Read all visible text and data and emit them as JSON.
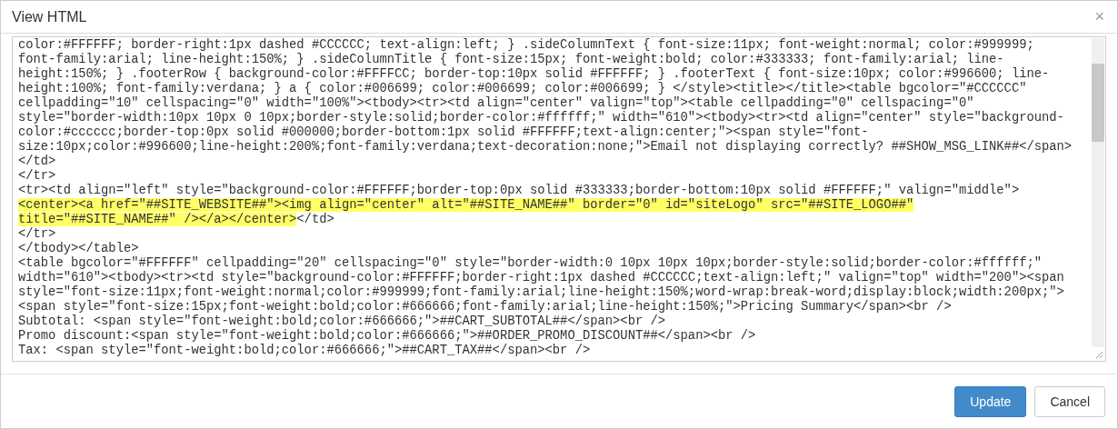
{
  "dialog": {
    "title": "View HTML",
    "close": "×"
  },
  "editor": {
    "lines": [
      {
        "segments": [
          {
            "text": "color:#FFFFFF; border-right:1px dashed #CCCCCC; text-align:left; } .sideColumnText { font-size:11px; font-weight:normal; color:#999999;",
            "highlighted": false
          }
        ]
      },
      {
        "segments": [
          {
            "text": "font-family:arial; line-height:150%; } .sideColumnTitle { font-size:15px; font-weight:bold; color:#333333; font-family:arial; line-",
            "highlighted": false
          }
        ]
      },
      {
        "segments": [
          {
            "text": "height:150%; } .footerRow { background-color:#FFFFCC; border-top:10px solid #FFFFFF; } .footerText { font-size:10px; color:#996600; line-",
            "highlighted": false
          }
        ]
      },
      {
        "segments": [
          {
            "text": "height:100%; font-family:verdana; } a { color:#006699; color:#006699; color:#006699; } </style><title></title><table bgcolor=\"#CCCCCC\"",
            "highlighted": false
          }
        ]
      },
      {
        "segments": [
          {
            "text": "cellpadding=\"10\" cellspacing=\"0\" width=\"100%\"><tbody><tr><td align=\"center\" valign=\"top\"><table cellpadding=\"0\" cellspacing=\"0\"",
            "highlighted": false
          }
        ]
      },
      {
        "segments": [
          {
            "text": "style=\"border-width:10px 10px 0 10px;border-style:solid;border-color:#ffffff;\" width=\"610\"><tbody><tr><td align=\"center\" style=\"background-",
            "highlighted": false
          }
        ]
      },
      {
        "segments": [
          {
            "text": "color:#cccccc;border-top:0px solid #000000;border-bottom:1px solid #FFFFFF;text-align:center;\"><span style=\"font-",
            "highlighted": false
          }
        ]
      },
      {
        "segments": [
          {
            "text": "size:10px;color:#996600;line-height:200%;font-family:verdana;text-decoration:none;\">Email not displaying correctly? ##SHOW_MSG_LINK##</span>",
            "highlighted": false
          }
        ]
      },
      {
        "segments": [
          {
            "text": "</td>",
            "highlighted": false
          }
        ]
      },
      {
        "segments": [
          {
            "text": "</tr>",
            "highlighted": false
          }
        ]
      },
      {
        "segments": [
          {
            "text": "<tr><td align=\"left\" style=\"background-color:#FFFFFF;border-top:0px solid #333333;border-bottom:10px solid #FFFFFF;\" valign=\"middle\">",
            "highlighted": false
          }
        ]
      },
      {
        "segments": [
          {
            "text": "<center><a href=\"##SITE_WEBSITE##\"><img align=\"center\" alt=\"##SITE_NAME##\" border=\"0\" id=\"siteLogo\" src=\"##SITE_LOGO##\"",
            "highlighted": true
          }
        ]
      },
      {
        "segments": [
          {
            "text": "title=\"##SITE_NAME##\" /></a></center>",
            "highlighted": true
          },
          {
            "text": "</td>",
            "highlighted": false
          }
        ]
      },
      {
        "segments": [
          {
            "text": "</tr>",
            "highlighted": false
          }
        ]
      },
      {
        "segments": [
          {
            "text": "</tbody></table>",
            "highlighted": false
          }
        ]
      },
      {
        "segments": [
          {
            "text": "<table bgcolor=\"#FFFFFF\" cellpadding=\"20\" cellspacing=\"0\" style=\"border-width:0 10px 10px 10px;border-style:solid;border-color:#ffffff;\"",
            "highlighted": false
          }
        ]
      },
      {
        "segments": [
          {
            "text": "width=\"610\"><tbody><tr><td style=\"background-color:#FFFFFF;border-right:1px dashed #CCCCCC;text-align:left;\" valign=\"top\" width=\"200\"><span",
            "highlighted": false
          }
        ]
      },
      {
        "segments": [
          {
            "text": "style=\"font-size:11px;font-weight:normal;color:#999999;font-family:arial;line-height:150%;word-wrap:break-word;display:block;width:200px;\">",
            "highlighted": false
          }
        ]
      },
      {
        "segments": [
          {
            "text": "<span style=\"font-size:15px;font-weight:bold;color:#666666;font-family:arial;line-height:150%;\">Pricing Summary</span><br />",
            "highlighted": false
          }
        ]
      },
      {
        "segments": [
          {
            "text": "Subtotal: <span style=\"font-weight:bold;color:#666666;\">##CART_SUBTOTAL##</span><br />",
            "highlighted": false
          }
        ]
      },
      {
        "segments": [
          {
            "text": "Promo discount:<span style=\"font-weight:bold;color:#666666;\">##ORDER_PROMO_DISCOUNT##</span><br />",
            "highlighted": false
          }
        ]
      },
      {
        "segments": [
          {
            "text": "Tax: <span style=\"font-weight:bold;color:#666666;\">##CART_TAX##</span><br />",
            "highlighted": false
          }
        ]
      }
    ]
  },
  "buttons": [
    {
      "label": "Update",
      "kind": "primary"
    },
    {
      "label": "Cancel",
      "kind": "default"
    }
  ]
}
